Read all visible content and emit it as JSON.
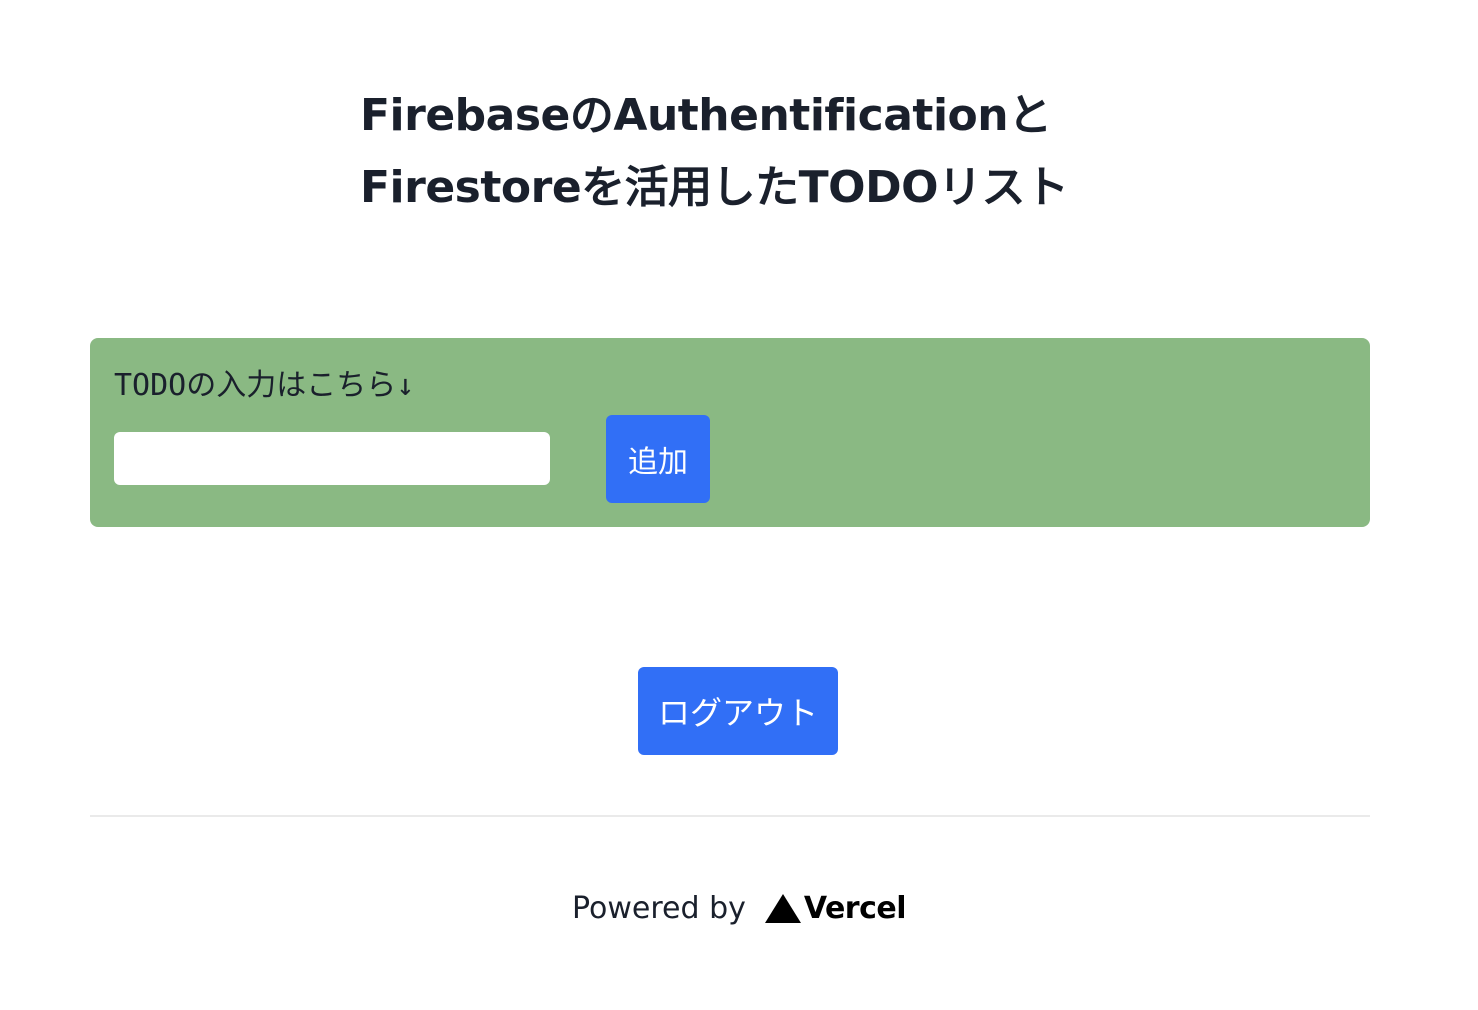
{
  "header": {
    "title_line1": "FirebaseのAuthentificationと",
    "title_line2": "Firestoreを活用したTODOリスト"
  },
  "todo_form": {
    "label": "TODOの入力はこちら↓",
    "input_value": "",
    "input_placeholder": "",
    "add_button_label": "追加",
    "panel_color": "#8ab983"
  },
  "logout": {
    "button_label": "ログアウト"
  },
  "footer": {
    "powered_by": "Powered by",
    "logo_icon": "vercel-triangle-icon",
    "brand": "Vercel"
  },
  "colors": {
    "accent": "#316ff6",
    "text": "#1a202c",
    "divider": "#eaeaea"
  }
}
